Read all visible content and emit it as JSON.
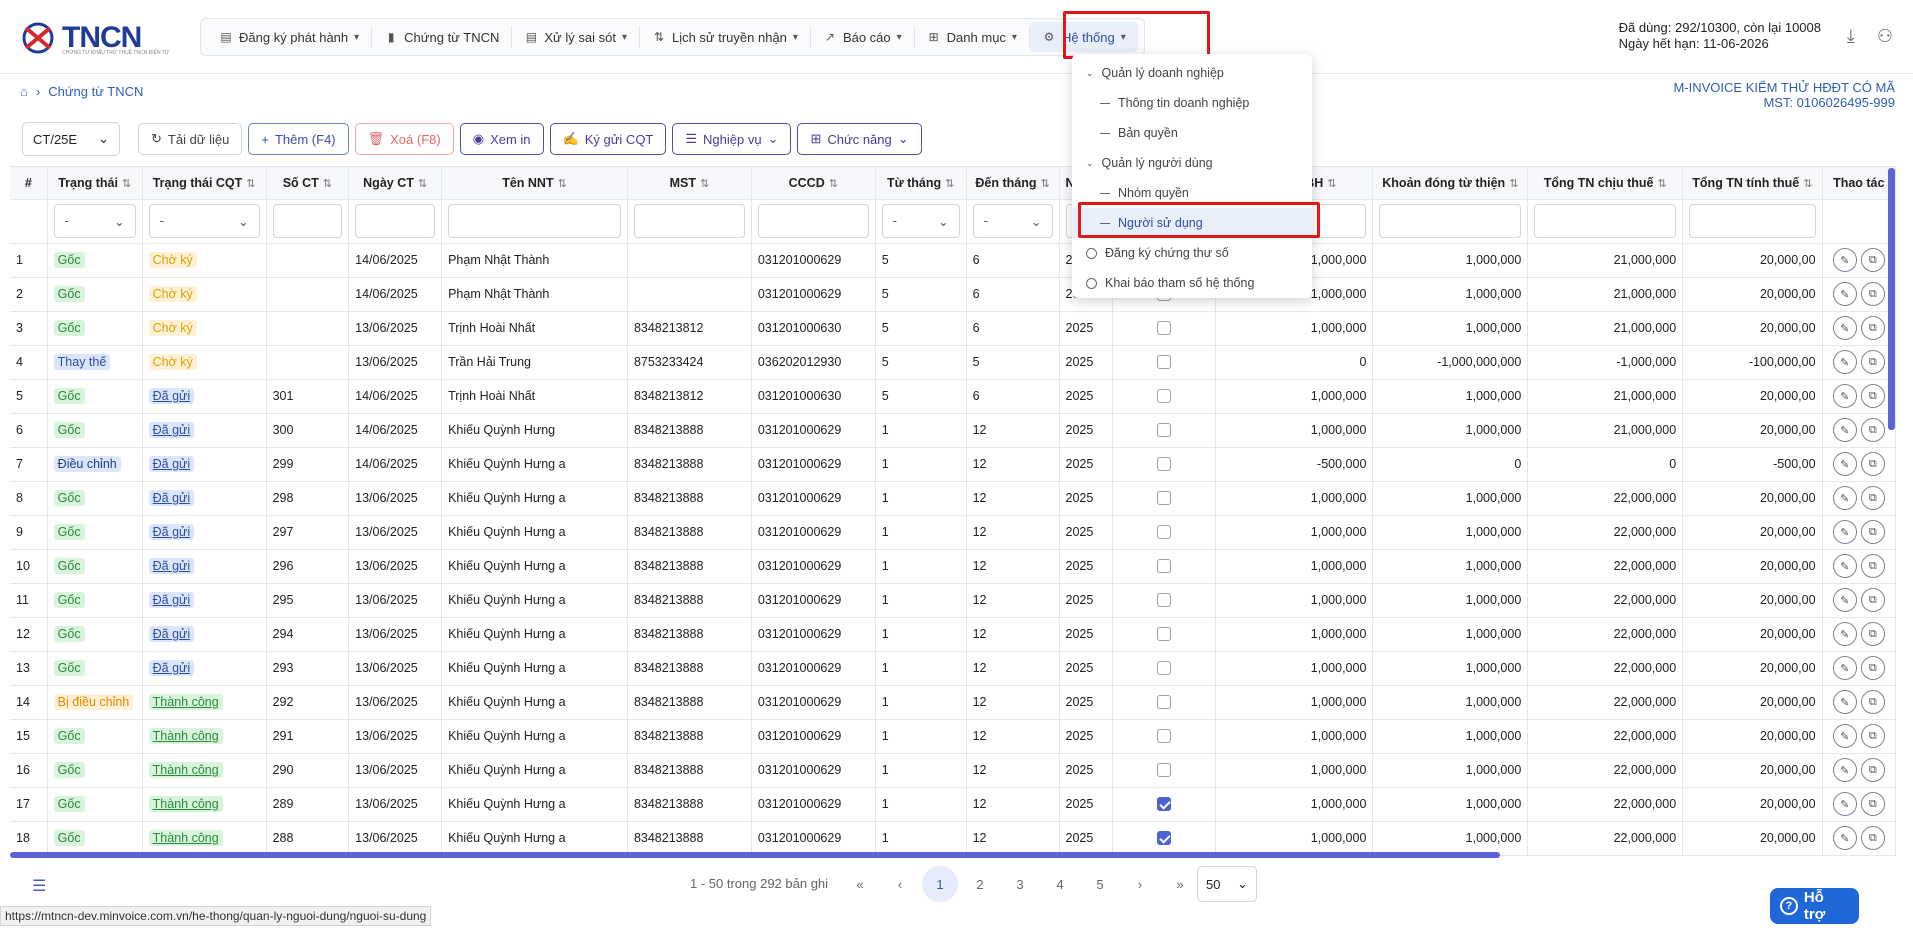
{
  "app": {
    "logo_text": "TNCN",
    "logo_sub": "CHỨNG TỪ KHẤU TRỪ THUẾ TNCN ĐIỆN TỬ"
  },
  "nav": [
    {
      "label": "Đăng ký phát hành",
      "icon": "file-icon"
    },
    {
      "label": "Chứng từ TNCN",
      "icon": "document-icon"
    },
    {
      "label": "Xử lý sai sót",
      "icon": "file-edit-icon"
    },
    {
      "label": "Lịch sử truyền nhận",
      "icon": "transfer-icon"
    },
    {
      "label": "Báo cáo",
      "icon": "chart-icon"
    },
    {
      "label": "Danh mục",
      "icon": "grid-icon"
    },
    {
      "label": "Hệ thống",
      "icon": "gear-icon"
    }
  ],
  "quota": {
    "line1": "Đã dùng: 292/10300, còn lại 10008",
    "line2": "Ngày hết hạn: 11-06-2026"
  },
  "breadcrumb": {
    "current": "Chứng từ TNCN"
  },
  "company": {
    "name": "M-INVOICE KIỂM THỬ HĐĐT CÓ MÃ",
    "tax": "MST: 0106026495-999"
  },
  "toolbar": {
    "template": "CT/25E",
    "reload": "Tải dữ liệu",
    "add": "Thêm (F4)",
    "delete": "Xoá (F8)",
    "view": "Xem in",
    "sign": "Ký gửi CQT",
    "ops": "Nghiệp vụ",
    "func": "Chức năng"
  },
  "columns": [
    "#",
    "Trạng thái",
    "Trạng thái CQT",
    "Số CT",
    "Ngày CT",
    "Tên NNT",
    "MST",
    "CCCD",
    "Từ tháng",
    "Đến tháng",
    "Na",
    "",
    "ng BH",
    "Khoản đóng từ thiện",
    "Tổng TN chịu thuế",
    "Tổng TN tính thuế",
    "Thao tác"
  ],
  "filter_dash": "-",
  "rows": [
    {
      "n": "1",
      "st": "Gốc",
      "stc": "goc",
      "cqt": "Chờ ký",
      "cqtc": "cho",
      "so": "",
      "ngay": "14/06/2025",
      "ten": "Phạm Nhật Thành",
      "mst": "",
      "cccd": "031201000629",
      "tu": "5",
      "den": "6",
      "nam": "2025",
      "cb": false,
      "bh": "1,000,000",
      "tt": "1,000,000",
      "cs": "21,000,000",
      "tinh": "20,000,00"
    },
    {
      "n": "2",
      "st": "Gốc",
      "stc": "goc",
      "cqt": "Chờ ký",
      "cqtc": "cho",
      "so": "",
      "ngay": "14/06/2025",
      "ten": "Phạm Nhật Thành",
      "mst": "",
      "cccd": "031201000629",
      "tu": "5",
      "den": "6",
      "nam": "2025",
      "cb": false,
      "bh": "1,000,000",
      "tt": "1,000,000",
      "cs": "21,000,000",
      "tinh": "20,000,00"
    },
    {
      "n": "3",
      "st": "Gốc",
      "stc": "goc",
      "cqt": "Chờ ký",
      "cqtc": "cho",
      "so": "",
      "ngay": "13/06/2025",
      "ten": "Trịnh Hoài Nhất",
      "mst": "8348213812",
      "cccd": "031201000630",
      "tu": "5",
      "den": "6",
      "nam": "2025",
      "cb": false,
      "bh": "1,000,000",
      "tt": "1,000,000",
      "cs": "21,000,000",
      "tinh": "20,000,00"
    },
    {
      "n": "4",
      "st": "Thay thế",
      "stc": "thay",
      "cqt": "Chờ ký",
      "cqtc": "cho",
      "so": "",
      "ngay": "13/06/2025",
      "ten": "Trần Hải Trung",
      "mst": "8753233424",
      "cccd": "036202012930",
      "tu": "5",
      "den": "5",
      "nam": "2025",
      "cb": false,
      "bh": "0",
      "tt": "-1,000,000,000",
      "cs": "-1,000,000",
      "tinh": "-100,000,00"
    },
    {
      "n": "5",
      "st": "Gốc",
      "stc": "goc",
      "cqt": "Đã gửi",
      "cqtc": "dagui",
      "so": "301",
      "ngay": "14/06/2025",
      "ten": "Trịnh Hoài Nhất",
      "mst": "8348213812",
      "cccd": "031201000630",
      "tu": "5",
      "den": "6",
      "nam": "2025",
      "cb": false,
      "bh": "1,000,000",
      "tt": "1,000,000",
      "cs": "21,000,000",
      "tinh": "20,000,00"
    },
    {
      "n": "6",
      "st": "Gốc",
      "stc": "goc",
      "cqt": "Đã gửi",
      "cqtc": "dagui",
      "so": "300",
      "ngay": "14/06/2025",
      "ten": "Khiếu Quỳnh Hưng",
      "mst": "8348213888",
      "cccd": "031201000629",
      "tu": "1",
      "den": "12",
      "nam": "2025",
      "cb": false,
      "bh": "1,000,000",
      "tt": "1,000,000",
      "cs": "21,000,000",
      "tinh": "20,000,00"
    },
    {
      "n": "7",
      "st": "Điều chỉnh",
      "stc": "dieu",
      "cqt": "Đã gửi",
      "cqtc": "dagui",
      "so": "299",
      "ngay": "14/06/2025",
      "ten": "Khiếu Quỳnh Hưng a",
      "mst": "8348213888",
      "cccd": "031201000629",
      "tu": "1",
      "den": "12",
      "nam": "2025",
      "cb": false,
      "bh": "-500,000",
      "tt": "0",
      "cs": "0",
      "tinh": "-500,00"
    },
    {
      "n": "8",
      "st": "Gốc",
      "stc": "goc",
      "cqt": "Đã gửi",
      "cqtc": "dagui",
      "so": "298",
      "ngay": "13/06/2025",
      "ten": "Khiếu Quỳnh Hưng a",
      "mst": "8348213888",
      "cccd": "031201000629",
      "tu": "1",
      "den": "12",
      "nam": "2025",
      "cb": false,
      "bh": "1,000,000",
      "tt": "1,000,000",
      "cs": "22,000,000",
      "tinh": "20,000,00"
    },
    {
      "n": "9",
      "st": "Gốc",
      "stc": "goc",
      "cqt": "Đã gửi",
      "cqtc": "dagui",
      "so": "297",
      "ngay": "13/06/2025",
      "ten": "Khiếu Quỳnh Hưng a",
      "mst": "8348213888",
      "cccd": "031201000629",
      "tu": "1",
      "den": "12",
      "nam": "2025",
      "cb": false,
      "bh": "1,000,000",
      "tt": "1,000,000",
      "cs": "22,000,000",
      "tinh": "20,000,00"
    },
    {
      "n": "10",
      "st": "Gốc",
      "stc": "goc",
      "cqt": "Đã gửi",
      "cqtc": "dagui",
      "so": "296",
      "ngay": "13/06/2025",
      "ten": "Khiếu Quỳnh Hưng a",
      "mst": "8348213888",
      "cccd": "031201000629",
      "tu": "1",
      "den": "12",
      "nam": "2025",
      "cb": false,
      "bh": "1,000,000",
      "tt": "1,000,000",
      "cs": "22,000,000",
      "tinh": "20,000,00"
    },
    {
      "n": "11",
      "st": "Gốc",
      "stc": "goc",
      "cqt": "Đã gửi",
      "cqtc": "dagui",
      "so": "295",
      "ngay": "13/06/2025",
      "ten": "Khiếu Quỳnh Hưng a",
      "mst": "8348213888",
      "cccd": "031201000629",
      "tu": "1",
      "den": "12",
      "nam": "2025",
      "cb": false,
      "bh": "1,000,000",
      "tt": "1,000,000",
      "cs": "22,000,000",
      "tinh": "20,000,00"
    },
    {
      "n": "12",
      "st": "Gốc",
      "stc": "goc",
      "cqt": "Đã gửi",
      "cqtc": "dagui",
      "so": "294",
      "ngay": "13/06/2025",
      "ten": "Khiếu Quỳnh Hưng a",
      "mst": "8348213888",
      "cccd": "031201000629",
      "tu": "1",
      "den": "12",
      "nam": "2025",
      "cb": false,
      "bh": "1,000,000",
      "tt": "1,000,000",
      "cs": "22,000,000",
      "tinh": "20,000,00"
    },
    {
      "n": "13",
      "st": "Gốc",
      "stc": "goc",
      "cqt": "Đã gửi",
      "cqtc": "dagui",
      "so": "293",
      "ngay": "13/06/2025",
      "ten": "Khiếu Quỳnh Hưng a",
      "mst": "8348213888",
      "cccd": "031201000629",
      "tu": "1",
      "den": "12",
      "nam": "2025",
      "cb": false,
      "bh": "1,000,000",
      "tt": "1,000,000",
      "cs": "22,000,000",
      "tinh": "20,000,00"
    },
    {
      "n": "14",
      "st": "Bị điều chỉnh",
      "stc": "bi",
      "cqt": "Thành công",
      "cqtc": "tc",
      "so": "292",
      "ngay": "13/06/2025",
      "ten": "Khiếu Quỳnh Hưng a",
      "mst": "8348213888",
      "cccd": "031201000629",
      "tu": "1",
      "den": "12",
      "nam": "2025",
      "cb": false,
      "bh": "1,000,000",
      "tt": "1,000,000",
      "cs": "22,000,000",
      "tinh": "20,000,00"
    },
    {
      "n": "15",
      "st": "Gốc",
      "stc": "goc",
      "cqt": "Thành công",
      "cqtc": "tc",
      "so": "291",
      "ngay": "13/06/2025",
      "ten": "Khiếu Quỳnh Hưng a",
      "mst": "8348213888",
      "cccd": "031201000629",
      "tu": "1",
      "den": "12",
      "nam": "2025",
      "cb": false,
      "bh": "1,000,000",
      "tt": "1,000,000",
      "cs": "22,000,000",
      "tinh": "20,000,00"
    },
    {
      "n": "16",
      "st": "Gốc",
      "stc": "goc",
      "cqt": "Thành công",
      "cqtc": "tc",
      "so": "290",
      "ngay": "13/06/2025",
      "ten": "Khiếu Quỳnh Hưng a",
      "mst": "8348213888",
      "cccd": "031201000629",
      "tu": "1",
      "den": "12",
      "nam": "2025",
      "cb": false,
      "bh": "1,000,000",
      "tt": "1,000,000",
      "cs": "22,000,000",
      "tinh": "20,000,00"
    },
    {
      "n": "17",
      "st": "Gốc",
      "stc": "goc",
      "cqt": "Thành công",
      "cqtc": "tc",
      "so": "289",
      "ngay": "13/06/2025",
      "ten": "Khiếu Quỳnh Hưng a",
      "mst": "8348213888",
      "cccd": "031201000629",
      "tu": "1",
      "den": "12",
      "nam": "2025",
      "cb": true,
      "bh": "1,000,000",
      "tt": "1,000,000",
      "cs": "22,000,000",
      "tinh": "20,000,00"
    },
    {
      "n": "18",
      "st": "Gốc",
      "stc": "goc",
      "cqt": "Thành công",
      "cqtc": "tc",
      "so": "288",
      "ngay": "13/06/2025",
      "ten": "Khiếu Quỳnh Hưng a",
      "mst": "8348213888",
      "cccd": "031201000629",
      "tu": "1",
      "den": "12",
      "nam": "2025",
      "cb": true,
      "bh": "1,000,000",
      "tt": "1,000,000",
      "cs": "22,000,000",
      "tinh": "20,000,00"
    }
  ],
  "menu": [
    {
      "label": "Quản lý doanh nghiệp",
      "kind": "group"
    },
    {
      "label": "Thông tin doanh nghiệp",
      "kind": "sub"
    },
    {
      "label": "Bản quyền",
      "kind": "sub"
    },
    {
      "label": "Quản lý người dùng",
      "kind": "group"
    },
    {
      "label": "Nhóm quyền",
      "kind": "sub"
    },
    {
      "label": "Người sử dụng",
      "kind": "sub",
      "selected": true
    },
    {
      "label": "Đăng ký chứng thư số",
      "kind": "leaf"
    },
    {
      "label": "Khai báo tham số hệ thống",
      "kind": "leaf"
    }
  ],
  "pagination": {
    "range": "1 - 50 trong 292 bản ghi",
    "pages": [
      "1",
      "2",
      "3",
      "4",
      "5"
    ],
    "current": "1",
    "page_size": "50"
  },
  "status_url": "https://mtncn-dev.minvoice.com.vn/he-thong/quan-ly-nguoi-dung/nguoi-su-dung",
  "support": "Hỗ trợ",
  "colors": {
    "accent": "#2d4ea8",
    "highlight": "#e01818",
    "scrollbar": "#5b63d6"
  }
}
